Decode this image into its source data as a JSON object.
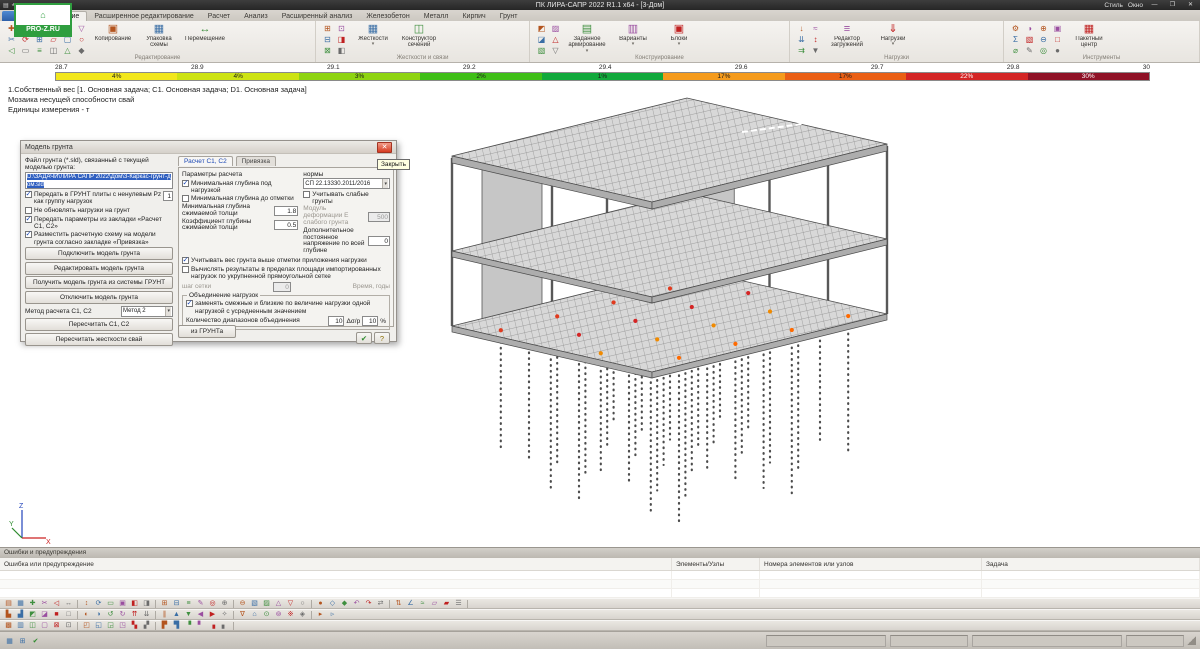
{
  "window": {
    "title": "ПК ЛИРА-САПР 2022 R1.1 x64 - [3-Дом]",
    "style_menu": "Стиль",
    "window_menu": "Окно",
    "min_glyph": "—",
    "restore_glyph": "❐",
    "close_glyph": "✕",
    "quick_access_icons": [
      "▤",
      "↶",
      "↷",
      "▦"
    ]
  },
  "logo": {
    "text": "PRO-Z.RU",
    "art_glyph": "⌂"
  },
  "ribbon": {
    "tabs": [
      {
        "label": "Редактирование",
        "active": true
      },
      {
        "label": "Расширенное редактирование",
        "active": false
      },
      {
        "label": "Расчет",
        "active": false
      },
      {
        "label": "Анализ",
        "active": false
      },
      {
        "label": "Расширенный анализ",
        "active": false
      },
      {
        "label": "Железобетон",
        "active": false
      },
      {
        "label": "Металл",
        "active": false
      },
      {
        "label": "Кирпич",
        "active": false
      },
      {
        "label": "Грунт",
        "active": false
      }
    ],
    "groups": [
      {
        "label": "Редактирование",
        "small_icons": [
          "✚",
          "✂",
          "◁",
          "↔",
          "⟳",
          "▭",
          "◧",
          "⊞",
          "≡",
          "✎",
          "▱",
          "◫",
          "⊟",
          "▢",
          "△",
          "▽",
          "○",
          "◆"
        ],
        "buttons": [
          {
            "label": "Копирование",
            "icon": "▣",
            "caret": false
          },
          {
            "label": "Упаковка схемы",
            "icon": "▦",
            "caret": false
          },
          {
            "label": "Перемещение",
            "icon": "↔",
            "caret": false
          }
        ]
      },
      {
        "label": "Жесткости и связи",
        "small_icons": [
          "⊞",
          "⊟",
          "⊠",
          "⊡",
          "◨",
          "◧"
        ],
        "buttons": [
          {
            "label": "Жесткости",
            "icon": "▦",
            "caret": true
          },
          {
            "label": "Конструктор сечений",
            "icon": "◫",
            "caret": false
          }
        ]
      },
      {
        "label": "Конструирование",
        "small_icons": [
          "◩",
          "◪",
          "▧",
          "▨",
          "△",
          "▽"
        ],
        "buttons": [
          {
            "label": "Заданное армирование",
            "icon": "▤",
            "caret": true
          },
          {
            "label": "Варианты",
            "icon": "▥",
            "caret": true
          },
          {
            "label": "Блоки",
            "icon": "▣",
            "caret": true
          }
        ]
      },
      {
        "label": "Нагрузки",
        "small_icons": [
          "↓",
          "⇊",
          "⇉",
          "≈",
          "↕",
          "▼"
        ],
        "buttons": [
          {
            "label": "Редактор загружений",
            "icon": "≡",
            "caret": false
          },
          {
            "label": "Нагрузки",
            "icon": "⇓",
            "caret": true
          }
        ]
      },
      {
        "label": "Инструменты",
        "small_icons": [
          "⚙",
          "Σ",
          "⌀",
          "◑",
          "▧",
          "✎",
          "⊕",
          "⊖",
          "◎",
          "▣",
          "□",
          "●"
        ],
        "buttons": [
          {
            "label": "Пакетный центр",
            "icon": "▦",
            "caret": false
          }
        ]
      }
    ]
  },
  "colorbar": {
    "ticks": [
      "28.7",
      "28.9",
      "29.1",
      "29.2",
      "29.4",
      "29.6",
      "29.7",
      "29.8",
      "30"
    ],
    "segments": [
      {
        "color": "#f2e71c",
        "label": "4%"
      },
      {
        "color": "#cde313",
        "label": "4%"
      },
      {
        "color": "#8ed411",
        "label": "3%"
      },
      {
        "color": "#3fbf17",
        "label": "2%"
      },
      {
        "color": "#11a93c",
        "label": "1%"
      },
      {
        "color": "#f59b1c",
        "label": "17%"
      },
      {
        "color": "#ea5f14",
        "label": "17%"
      },
      {
        "color": "#d42525",
        "label": "22%"
      },
      {
        "color": "#8f1126",
        "label": "30%"
      }
    ]
  },
  "info_lines": [
    "1.Собственный вес [1. Основная задача; C1. Основная задача; D1. Основная задача]",
    "Мозаика несущей способности свай",
    "Единицы измерения - т"
  ],
  "axes": {
    "x": "X",
    "y": "Y",
    "z": "Z"
  },
  "dialog": {
    "title": "Модель грунта",
    "close_glyph": "✕",
    "close_tooltip": "Закрыть",
    "file_label": "Файл грунта (*.sld), связанный с текущей моделью грунта:",
    "file_value": "D:\\ЗАДАЧИ\\ЛИРА САПР 2022\\Дом\\3-Каркас-грунт-дом.sld",
    "left_checks": [
      {
        "label": "Передать в ГРУНТ плиты с ненулевым Pz как группу нагрузок",
        "checked": true,
        "field": "1"
      },
      {
        "label": "Не обновлять нагрузки на грунт",
        "checked": false
      },
      {
        "label": "Передать параметры из закладки «Расчет С1, С2»",
        "checked": true
      },
      {
        "label": "Разместить расчетную схему на модели грунта согласно закладке «Привязка»",
        "checked": true
      }
    ],
    "left_buttons": [
      "Подключить модель грунта",
      "Редактировать модель грунта",
      "Получить модель грунта из системы ГРУНТ",
      "Отключить модель грунта"
    ],
    "method_label": "Метод расчета С1, С2",
    "method_value": "Метод 2",
    "recalc_buttons": [
      "Пересчитать С1, С2",
      "Пересчитать жесткости свай"
    ],
    "tabs": [
      {
        "label": "Расчет С1, С2",
        "active": true
      },
      {
        "label": "Привязка",
        "active": false
      }
    ],
    "params_title": "Параметры расчета",
    "norms_label": "нормы",
    "norms_value": "СП 22.13330.2011/2016",
    "p_checks": [
      {
        "label": "Минимальная глубина под нагрузкой",
        "checked": true
      },
      {
        "label": "Минимальная глубина до отметки",
        "checked": false
      }
    ],
    "depth_label": "Минимальная глубина сжимаемой толщи",
    "depth_value": "1.8",
    "coef_label": "Коэффициент глубины сжимаемой толщи",
    "coef_value": "0.5",
    "weak_check": {
      "label": "Учитывать слабые грунты",
      "checked": false
    },
    "weak_mod_label": "Модуль деформации Е слабого грунта",
    "weak_mod_value": "500",
    "extra_label": "Дополнительное постоянное напряжение по всей глубине",
    "extra_value": "0",
    "weight_check": {
      "label": "Учитывать вес грунта выше отметки приложения нагрузки",
      "checked": true
    },
    "grid_check": {
      "label": "Вычислять результаты в пределах площади импортированных нагрузок по укрупненной прямоугольной сетке",
      "checked": false
    },
    "grid_step_label": "шаг сетки",
    "grid_step_value": "0",
    "time_label": "Время, годы",
    "merge_group": "Объединение нагрузок",
    "merge_check": {
      "label": "заменять смежные и близкие по величине нагрузки одной нагрузкой с усредненным значением",
      "checked": true
    },
    "ranges_label": "Количество диапазонов объединения",
    "ranges_value": "10",
    "delta_label": "Δσ/р",
    "delta_value": "10",
    "percent_label": "%",
    "from_grunt_button": "из ГРУНТа",
    "ok_glyph": "✔",
    "help_glyph": "?"
  },
  "error_panel": {
    "title": "Ошибки и предупреждения",
    "columns": [
      "Ошибка или предупреждение",
      "Элементы/Узлы",
      "Номера элементов или узлов",
      "Задача"
    ]
  },
  "toolbars": {
    "row1": [
      "▤",
      "▦",
      "✚",
      "✂",
      "◁",
      "↔",
      "↕",
      "⟳",
      "▭",
      "▣",
      "◧",
      "◨",
      "⊞",
      "⊟",
      "≡",
      "✎",
      "◎",
      "⊕",
      "⊖",
      "▧",
      "▨",
      "△",
      "▽",
      "○",
      "●",
      "◇",
      "◆",
      "↶",
      "↷",
      "⇄",
      "⇅",
      "∠",
      "≈",
      "▱",
      "▰",
      "☰"
    ],
    "row2": [
      "▙",
      "▟",
      "◩",
      "◪",
      "■",
      "□",
      "◐",
      "◑",
      "↺",
      "↻",
      "⇈",
      "⇊",
      "∥",
      "▲",
      "▼",
      "◀",
      "▶",
      "✧",
      "∇",
      "⌂",
      "⊙",
      "⊚",
      "※",
      "◈",
      "▸",
      "▹"
    ],
    "row3": [
      "▩",
      "▥",
      "◫",
      "▢",
      "⊠",
      "⊡",
      "◰",
      "◱",
      "◲",
      "◳",
      "▚",
      "▞",
      "▛",
      "▜",
      "▝",
      "▘",
      "▗",
      "▖"
    ]
  },
  "statusbar": {
    "icons": [
      "▦",
      "⊞",
      "✔"
    ]
  }
}
